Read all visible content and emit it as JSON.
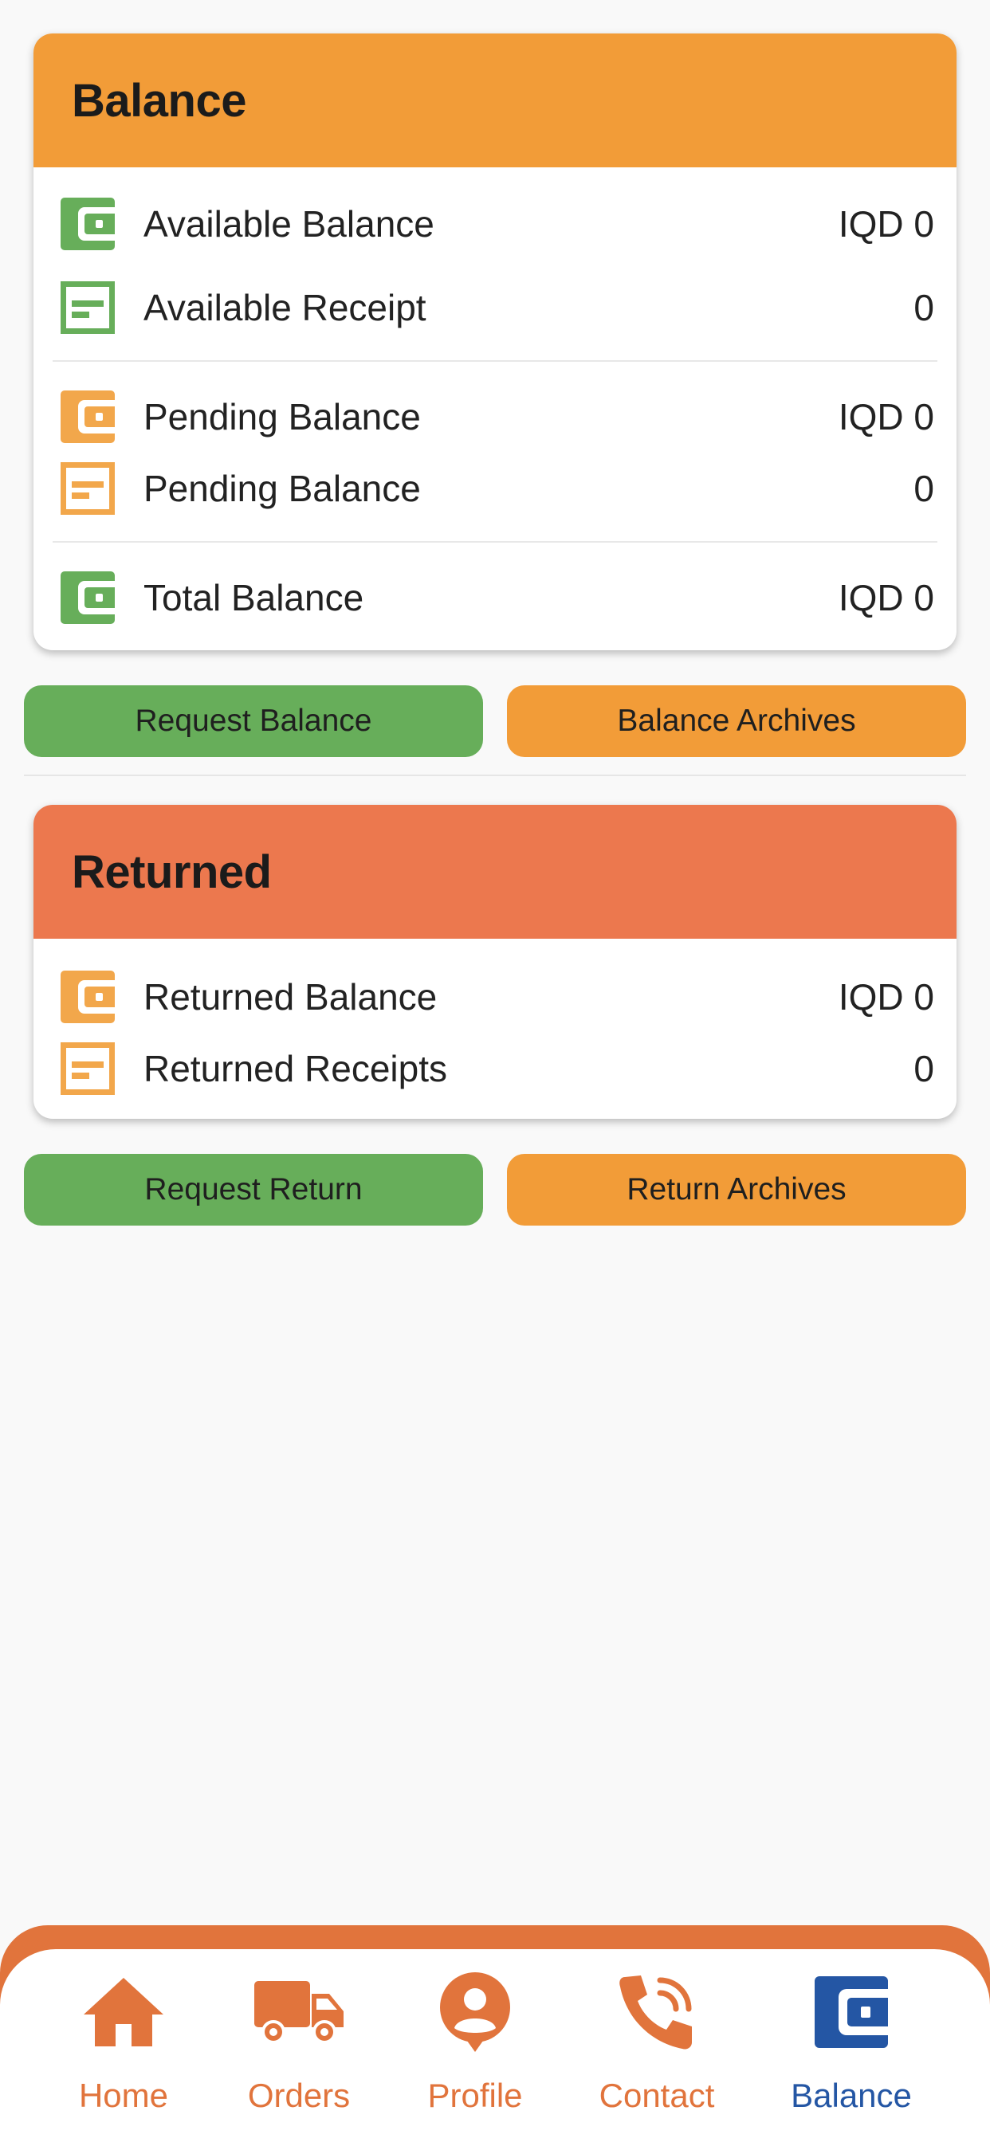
{
  "colors": {
    "balance_header": "#f29c38",
    "returned_header": "#ec784e",
    "green": "#67ae5a",
    "orange": "#f29c38",
    "nav_accent": "#e1743c",
    "nav_active": "#2456a4"
  },
  "balance": {
    "title": "Balance",
    "rows": [
      {
        "icon": "wallet-icon",
        "label": "Available Balance",
        "value": "IQD 0"
      },
      {
        "icon": "receipt-icon",
        "label": "Available Receipt",
        "value": "0"
      },
      {
        "icon": "wallet-icon",
        "label": "Pending Balance",
        "value": "IQD 0"
      },
      {
        "icon": "receipt-icon",
        "label": "Pending Balance",
        "value": "0"
      },
      {
        "icon": "wallet-icon",
        "label": "Total Balance",
        "value": "IQD 0"
      }
    ],
    "request_label": "Request Balance",
    "archives_label": "Balance Archives"
  },
  "returned": {
    "title": "Returned",
    "rows": [
      {
        "icon": "wallet-icon",
        "label": "Returned Balance",
        "value": "IQD 0"
      },
      {
        "icon": "receipt-icon",
        "label": "Returned Receipts",
        "value": "0"
      }
    ],
    "request_label": "Request Return",
    "archives_label": "Return Archives"
  },
  "nav": {
    "items": [
      {
        "label": "Home",
        "icon": "home-icon"
      },
      {
        "label": "Orders",
        "icon": "truck-icon"
      },
      {
        "label": "Profile",
        "icon": "profile-icon"
      },
      {
        "label": "Contact",
        "icon": "phone-icon"
      },
      {
        "label": "Balance",
        "icon": "wallet-icon",
        "active": true
      }
    ]
  }
}
